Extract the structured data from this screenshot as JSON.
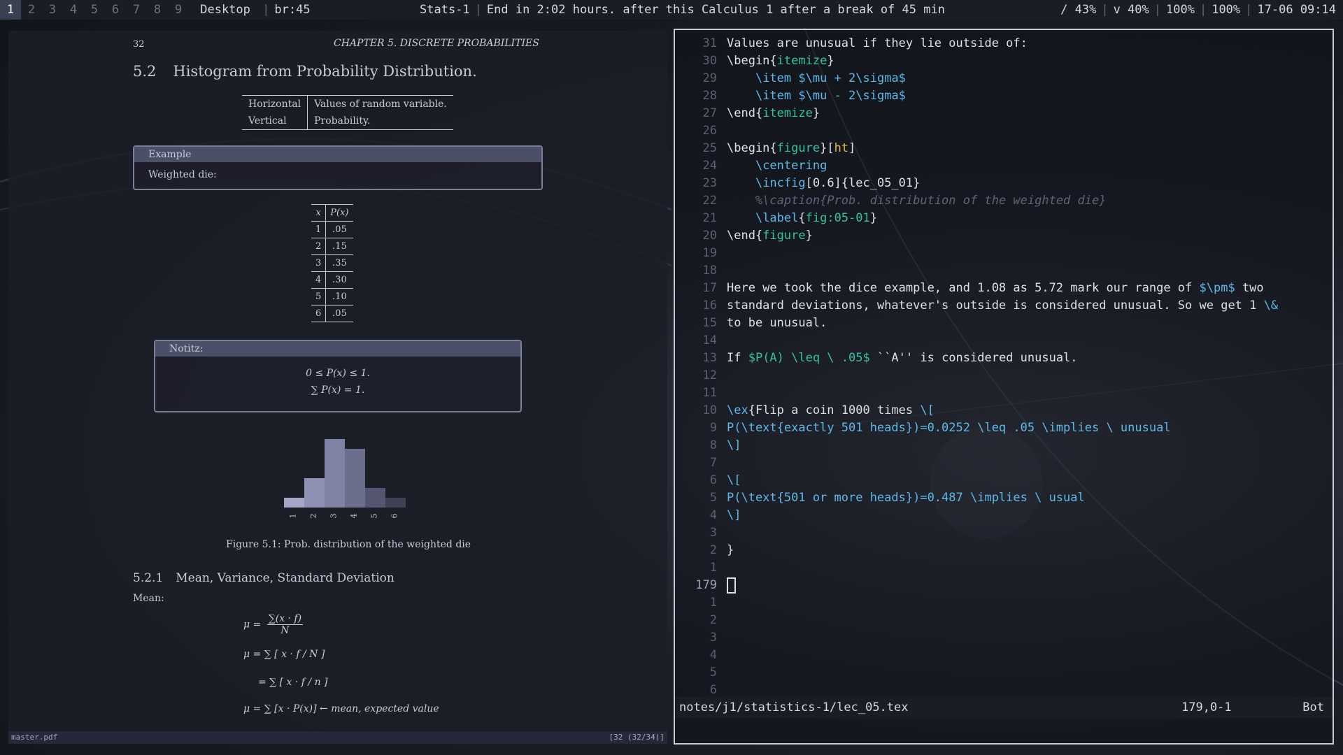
{
  "topbar": {
    "workspaces": [
      "1",
      "2",
      "3",
      "4",
      "5",
      "6",
      "7",
      "8",
      "9"
    ],
    "active_workspace": "1",
    "layout": "Desktop",
    "block_left": "br:45",
    "window_title": "Stats-1",
    "message": "End in 2:02 hours. after this Calculus 1 after a break of 45 min",
    "disk": "/ 43%",
    "volume": "v 40%",
    "brightness": "100%",
    "battery": "100%",
    "datetime": "17-06 09:14"
  },
  "pdf": {
    "page_number": "32",
    "chapter_header": "CHAPTER 5.  DISCRETE PROBABILITIES",
    "section_number": "5.2",
    "section_title": "Histogram from Probability Distribution.",
    "axis_table": [
      [
        "Horizontal",
        "Values of random variable."
      ],
      [
        "Vertical",
        "Probability."
      ]
    ],
    "example_box": {
      "title": "Example",
      "body": "Weighted die:"
    },
    "dist_table": {
      "header": [
        "x",
        "P(x)"
      ],
      "rows": [
        [
          "1",
          ".05"
        ],
        [
          "2",
          ".15"
        ],
        [
          "3",
          ".35"
        ],
        [
          "4",
          ".30"
        ],
        [
          "5",
          ".10"
        ],
        [
          "6",
          ".05"
        ]
      ]
    },
    "notiz_box": {
      "title": "Notitz:",
      "eq1": "0 ≤ P(x) ≤ 1.",
      "eq2": "∑ P(x) = 1."
    },
    "histogram": {
      "categories": [
        "1",
        "2",
        "3",
        "4",
        "5",
        "6"
      ],
      "values": [
        0.05,
        0.15,
        0.35,
        0.3,
        0.1,
        0.05
      ],
      "colors": [
        "#a3a6c7",
        "#8e91b3",
        "#7f82a3",
        "#6c6f8c",
        "#53566e",
        "#3f4255"
      ]
    },
    "figure_caption": "Figure 5.1: Prob. distribution of the weighted die",
    "subsection_number": "5.2.1",
    "subsection_title": "Mean, Variance, Standard Deviation",
    "mean_label": "Mean:",
    "formulas": {
      "f1_lhs": "μ =",
      "f1_num": "∑(x · f)",
      "f1_den": "N",
      "f2": "μ = ∑ [ x · f / N ]",
      "f3": "= ∑ [ x · f / n ]",
      "f4": "μ = ∑ [x · P(x)] ← mean, expected value"
    },
    "status_left": "master.pdf",
    "status_right": "[32 (32/34)]"
  },
  "vim": {
    "lines": [
      {
        "n": "31",
        "html": "Values are unusual if they lie outside of:"
      },
      {
        "n": "30",
        "html": "\\begin{<span class='g'>itemize</span>}"
      },
      {
        "n": "29",
        "html": "    <span class='k'>\\item</span> <span class='k'>$\\mu + 2\\sigma$</span>"
      },
      {
        "n": "28",
        "html": "    <span class='k'>\\item</span> <span class='k'>$\\mu - 2\\sigma$</span>"
      },
      {
        "n": "27",
        "html": "\\end{<span class='g'>itemize</span>}"
      },
      {
        "n": "26",
        "html": ""
      },
      {
        "n": "25",
        "html": "\\begin{<span class='g'>figure</span>}[<span class='y'>ht</span>]"
      },
      {
        "n": "24",
        "html": "    <span class='k'>\\centering</span>"
      },
      {
        "n": "23",
        "html": "    <span class='k'>\\incfig</span>[0.6]{lec_05_01}"
      },
      {
        "n": "22",
        "html": "    <span class='c'>%\\caption{Prob. distribution of the weighted die}</span>"
      },
      {
        "n": "21",
        "html": "    <span class='k'>\\label</span>{<span class='g'>fig:05-01</span>}"
      },
      {
        "n": "20",
        "html": "\\end{<span class='g'>figure</span>}"
      },
      {
        "n": "19",
        "html": ""
      },
      {
        "n": "18",
        "html": ""
      },
      {
        "n": "17",
        "html": "Here we took the dice example, and 1.08 as 5.72 mark our range of <span class='k'>$\\pm$</span> two"
      },
      {
        "n": "16",
        "html": "standard deviations, whatever's outside is considered unusual. So we get 1 <span class='k'>\\&amp;</span>"
      },
      {
        "n": "15",
        "html": "to be unusual."
      },
      {
        "n": "14",
        "html": ""
      },
      {
        "n": "13",
        "html": "If <span class='g'>$P(A) \\leq \\ .05$</span> ``A'' is considered unusual."
      },
      {
        "n": "12",
        "html": ""
      },
      {
        "n": "11",
        "html": ""
      },
      {
        "n": "10",
        "html": "<span class='k'>\\ex</span>{Flip a coin 1000 times <span class='k'>\\[</span>"
      },
      {
        "n": "9",
        "html": "<span class='k'>P(\\text{exactly 501 heads})=0.0252 \\leq .05 \\implies \\ unusual</span>"
      },
      {
        "n": "8",
        "html": "<span class='k'>\\]</span>"
      },
      {
        "n": "7",
        "html": ""
      },
      {
        "n": "6",
        "html": "<span class='k'>\\[</span>"
      },
      {
        "n": "5",
        "html": "<span class='k'>P(\\text{501 or more heads})=0.487 \\implies \\ usual</span>"
      },
      {
        "n": "4",
        "html": "<span class='k'>\\]</span>"
      },
      {
        "n": "3",
        "html": ""
      },
      {
        "n": "2",
        "html": "}"
      },
      {
        "n": "1",
        "html": ""
      },
      {
        "n": "179",
        "html": "<span id='cursor' data-name='text-cursor' data-interactable='false'></span>",
        "current": true
      },
      {
        "n": "1",
        "html": ""
      },
      {
        "n": "2",
        "html": ""
      },
      {
        "n": "3",
        "html": ""
      },
      {
        "n": "4",
        "html": ""
      },
      {
        "n": "5",
        "html": ""
      },
      {
        "n": "6",
        "html": ""
      }
    ],
    "status_file": "notes/j1/statistics-1/lec_05.tex",
    "status_position": "179,0-1",
    "status_scroll": "Bot"
  }
}
